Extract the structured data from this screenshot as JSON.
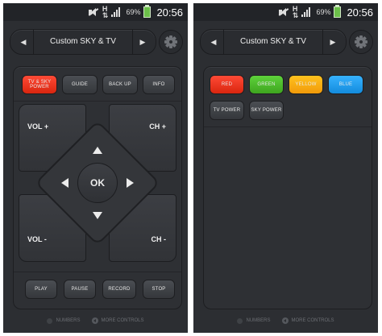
{
  "status_bar": {
    "battery": "69%",
    "time": "20:56"
  },
  "header": {
    "title": "Custom SKY & TV"
  },
  "left_screen": {
    "top_buttons": [
      "TV & SKY POWER",
      "GUIDE",
      "BACK UP",
      "INFO"
    ],
    "dpad": {
      "vol_up": "VOL +",
      "ch_up": "CH +",
      "vol_down": "VOL -",
      "ch_down": "CH -",
      "ok": "OK"
    },
    "bottom_buttons": [
      "PLAY",
      "PAUSE",
      "RECORD",
      "STOP"
    ]
  },
  "right_screen": {
    "color_buttons": [
      "RED",
      "GREEN",
      "YELLOW",
      "BLUE"
    ],
    "custom_buttons": [
      "TV POWER",
      "SKY POWER"
    ]
  },
  "footer": {
    "numbers": "NUMBERS",
    "more_controls": "MORE CONTROLS"
  },
  "colors": {
    "red": "#e8331f",
    "green": "#4cbf2a",
    "yellow": "#f7ad12",
    "blue": "#229ff0",
    "panel": "#2e3034"
  }
}
